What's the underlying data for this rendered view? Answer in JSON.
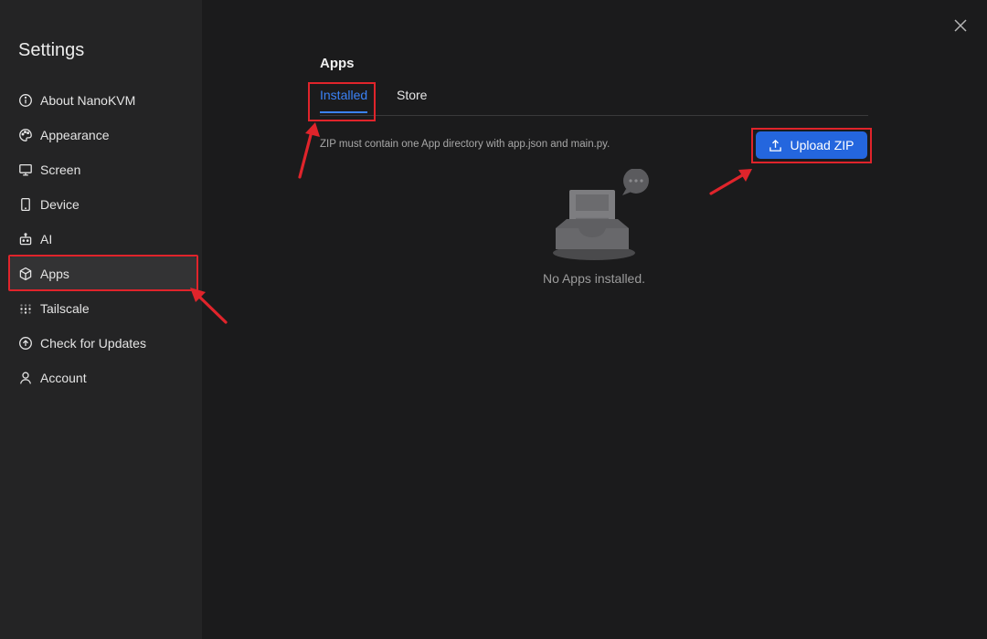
{
  "sidebar": {
    "title": "Settings",
    "items": [
      {
        "label": "About NanoKVM",
        "icon": "info-icon"
      },
      {
        "label": "Appearance",
        "icon": "palette-icon"
      },
      {
        "label": "Screen",
        "icon": "monitor-icon"
      },
      {
        "label": "Device",
        "icon": "phone-icon"
      },
      {
        "label": "AI",
        "icon": "robot-icon"
      },
      {
        "label": "Apps",
        "icon": "package-icon",
        "active": true
      },
      {
        "label": "Tailscale",
        "icon": "tailscale-icon"
      },
      {
        "label": "Check for Updates",
        "icon": "arrow-up-circle-icon"
      },
      {
        "label": "Account",
        "icon": "user-icon"
      }
    ]
  },
  "main": {
    "title": "Apps",
    "tabs": [
      {
        "label": "Installed",
        "active": true
      },
      {
        "label": "Store"
      }
    ],
    "hint": "ZIP must contain one App directory with app.json and main.py.",
    "upload_label": "Upload ZIP",
    "empty_text": "No Apps installed."
  },
  "colors": {
    "accent": "#2466de",
    "annotation": "#e0242b"
  }
}
